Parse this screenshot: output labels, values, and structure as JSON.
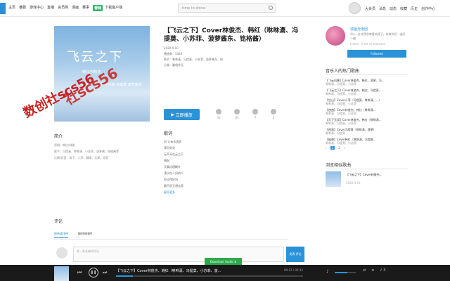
{
  "nav": {
    "items": [
      "主页",
      "番剧",
      "游戏中心",
      "直播",
      "会员购",
      "漫画",
      "赛事"
    ],
    "badge": "春晚",
    "download": "下载客户端"
  },
  "search": {
    "placeholder": "time to shine"
  },
  "right_nav": [
    "大会员",
    "消息",
    "动态",
    "收藏",
    "历史",
    "创作中心"
  ],
  "song": {
    "title": "【飞云之下】Cover林俊杰、韩红（咻咻潇、冯提莫、小苏菲、菠萝酱东、铭格酱）",
    "meta_date": "2020-4-10",
    "meta_plays": "播放数：5420",
    "meta_singers": "歌手：咻咻潇、冯提莫、小苏菲、菠萝酱东、铭",
    "meta_category": "分类：翻唱作品",
    "play_label": "立即播放",
    "actions": [
      {
        "label": "收藏",
        "count": "43"
      },
      {
        "label": "投币",
        "count": "83"
      },
      {
        "label": "评论",
        "count": "7"
      },
      {
        "label": "分享",
        "count": "5"
      }
    ]
  },
  "cover": {
    "title": "飞云之下",
    "sub": "韩红/林俊杰",
    "line": "演唱：咻咻潇 小苏菲 冯提莫 菠萝酱东",
    "watermark": "社scs56"
  },
  "stamp": "数创社scs56",
  "intro": {
    "heading": "简介",
    "lines": [
      "原唱：韩红/林俊",
      "歌手：冯提莫、咻咻潇、小苏菲、菠萝酱、铭格酱等",
      "后期/混音：南下、人声、翻唱、后期、混音"
    ]
  },
  "lyrics": {
    "heading": "歌词",
    "lines": [
      "风 让云去流浪",
      "漂天的花",
      "无声开在云之下",
      "想起",
      "又飘远模糊许",
      "漂沙在人间的人",
      "你过得好吗",
      "最不愿又想念家"
    ],
    "more": "展开更多"
  },
  "comments": {
    "heading": "评论",
    "tabs": [
      "按热度排序",
      "按时间排序"
    ],
    "placeholder": "发一条友善的评论",
    "submit": "发表\n评论"
  },
  "download_audio": "Download Audio ⬇",
  "uploader": {
    "name": "漫画光谱团",
    "desc": "A与一台对我非常喜欢我了。带来你们一遍又一遍",
    "stats": "Listen · A list of someone",
    "follow": "Followed"
  },
  "hot": {
    "heading": "音乐人的热门歌曲",
    "items": [
      {
        "title": "【飞云风暴】Cover林俊杰、韩红，菠萝、冯...",
        "sub": "咻咻潇、冯提莫、小苏菲"
      },
      {
        "title": "【飞云之下】Cover林俊杰、韩红，冯提莫、...",
        "sub": "咻咻潇、冯提莫、小苏菲"
      },
      {
        "title": "【空山】Cover小菲（冯提莫、咻咻潇、...）",
        "sub": "咻咻潇、冯提莫、小苏菲"
      },
      {
        "title": "【夜曲】Cover林俊杰、韩红（咻咻潇...",
        "sub": "咻咻潇、冯提莫、小苏菲"
      },
      {
        "title": "【天下无双】Cover林俊杰、韩红（咻咻潇...",
        "sub": "咻咻潇、冯提莫、小苏菲"
      },
      {
        "title": "【夜雨】Cover冯提莫（咻咻潇、菠萝）",
        "sub": "咻咻潇、冯提莫"
      },
      {
        "title": "【破晓】Cover韩红（咻咻潇、冯提莫...",
        "sub": "咻咻潇、冯提莫、小苏菲"
      }
    ],
    "pages": [
      "‹",
      "1",
      "2",
      "›"
    ]
  },
  "recent": {
    "heading": "浏览相似歌曲",
    "title": "【飞云之下】Cover林俊杰...",
    "count": "2020.4.10"
  },
  "player": {
    "title": "【飞云之下】Cover林俊杰、韩红（咻咻潇、冯提莫、小苏菲、菠...",
    "time": "00:27 / 05:12",
    "progress": 0.09,
    "volume": 0.6,
    "right": [
      "⇄",
      "≡",
      "♪ 3"
    ]
  }
}
